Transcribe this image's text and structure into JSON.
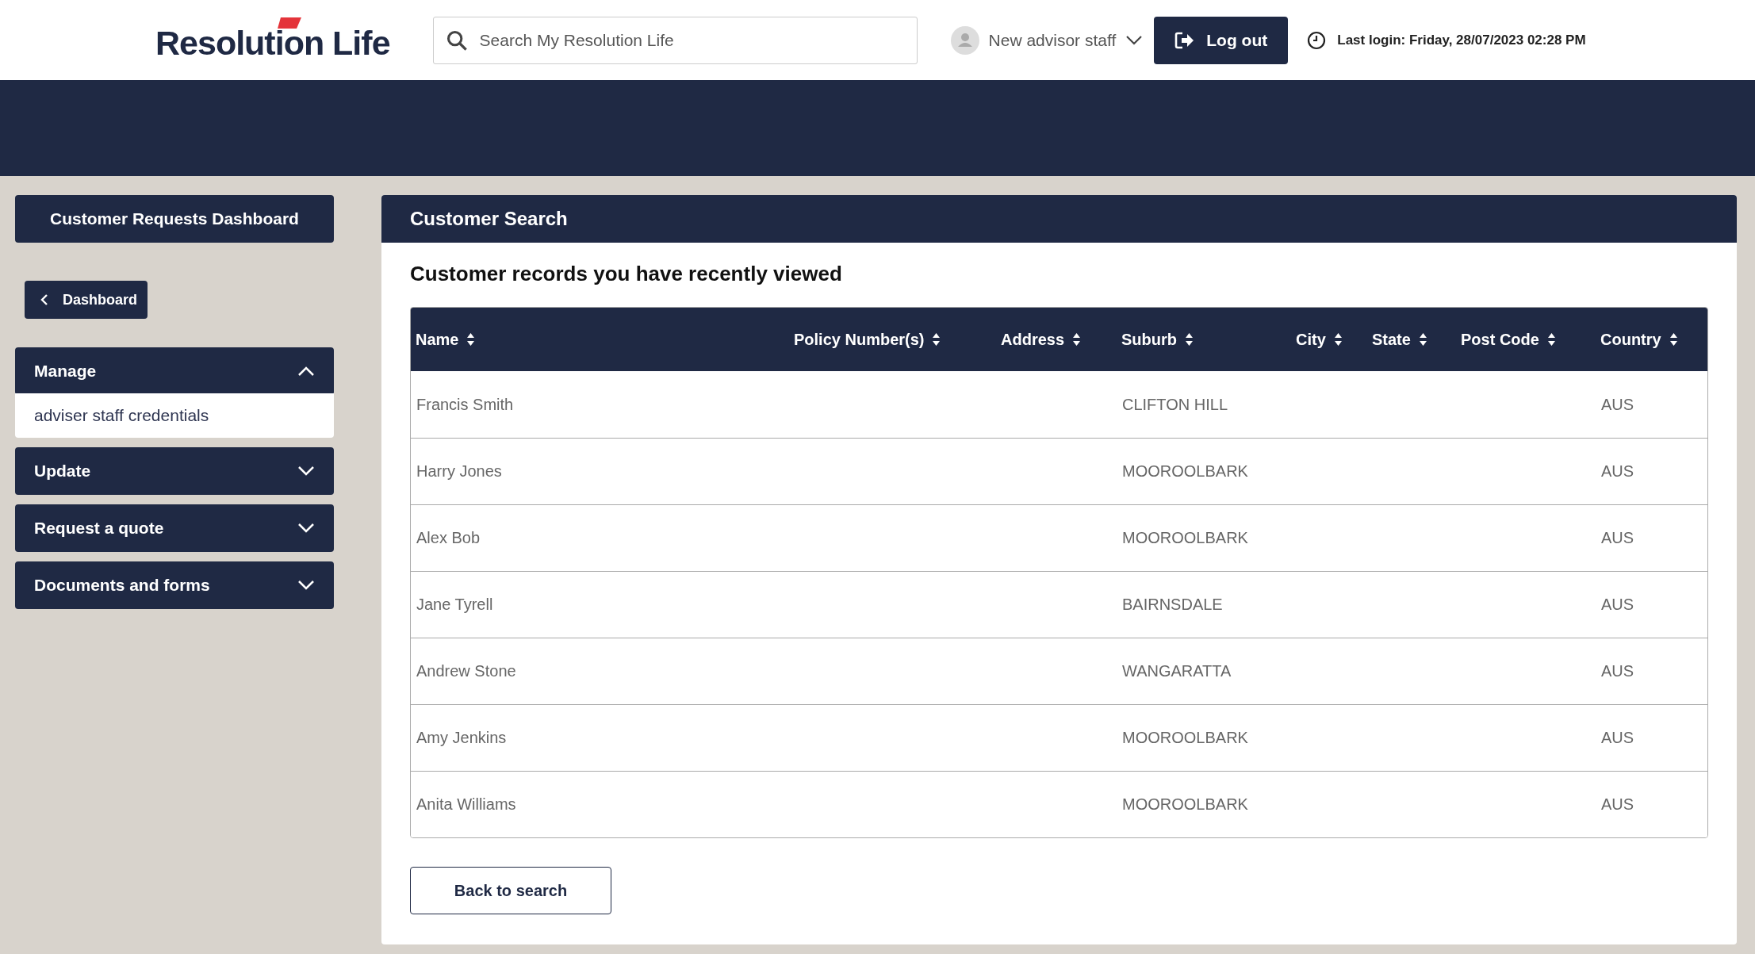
{
  "header": {
    "logo": "Resolution Life",
    "search": {
      "placeholder": "Search My Resolution Life"
    },
    "user": "New advisor staff",
    "logout": "Log out",
    "last_login": "Last login: Friday, 28/07/2023 02:28 PM"
  },
  "sidebar": {
    "dashboard_button": "Customer Requests Dashboard",
    "back_button": "Dashboard",
    "menus": [
      {
        "label": "Manage",
        "expanded": true,
        "items": [
          "adviser staff credentials"
        ]
      },
      {
        "label": "Update",
        "expanded": false
      },
      {
        "label": "Request a quote",
        "expanded": false
      },
      {
        "label": "Documents and forms",
        "expanded": false
      }
    ]
  },
  "panel": {
    "title": "Customer Search",
    "subtitle": "Customer records you have recently viewed",
    "table": {
      "columns": [
        "Name",
        "Policy Number(s)",
        "Address",
        "Suburb",
        "City",
        "State",
        "Post Code",
        "Country"
      ],
      "rows": [
        [
          "Francis Smith",
          "",
          "",
          "CLIFTON HILL",
          "",
          "",
          "",
          "AUS"
        ],
        [
          "Harry Jones",
          "",
          "",
          "MOOROOLBARK",
          "",
          "",
          "",
          "AUS"
        ],
        [
          "Alex Bob",
          "",
          "",
          "MOOROOLBARK",
          "",
          "",
          "",
          "AUS"
        ],
        [
          "Jane Tyrell",
          "",
          "",
          "BAIRNSDALE",
          "",
          "",
          "",
          "AUS"
        ],
        [
          "Andrew Stone",
          "",
          "",
          "WANGARATTA",
          "",
          "",
          "",
          "AUS"
        ],
        [
          "Amy Jenkins",
          "",
          "",
          "MOOROOLBARK",
          "",
          "",
          "",
          "AUS"
        ],
        [
          "Anita Williams",
          "",
          "",
          "MOOROOLBARK",
          "",
          "",
          "",
          "AUS"
        ]
      ]
    },
    "back_button": "Back to search"
  }
}
